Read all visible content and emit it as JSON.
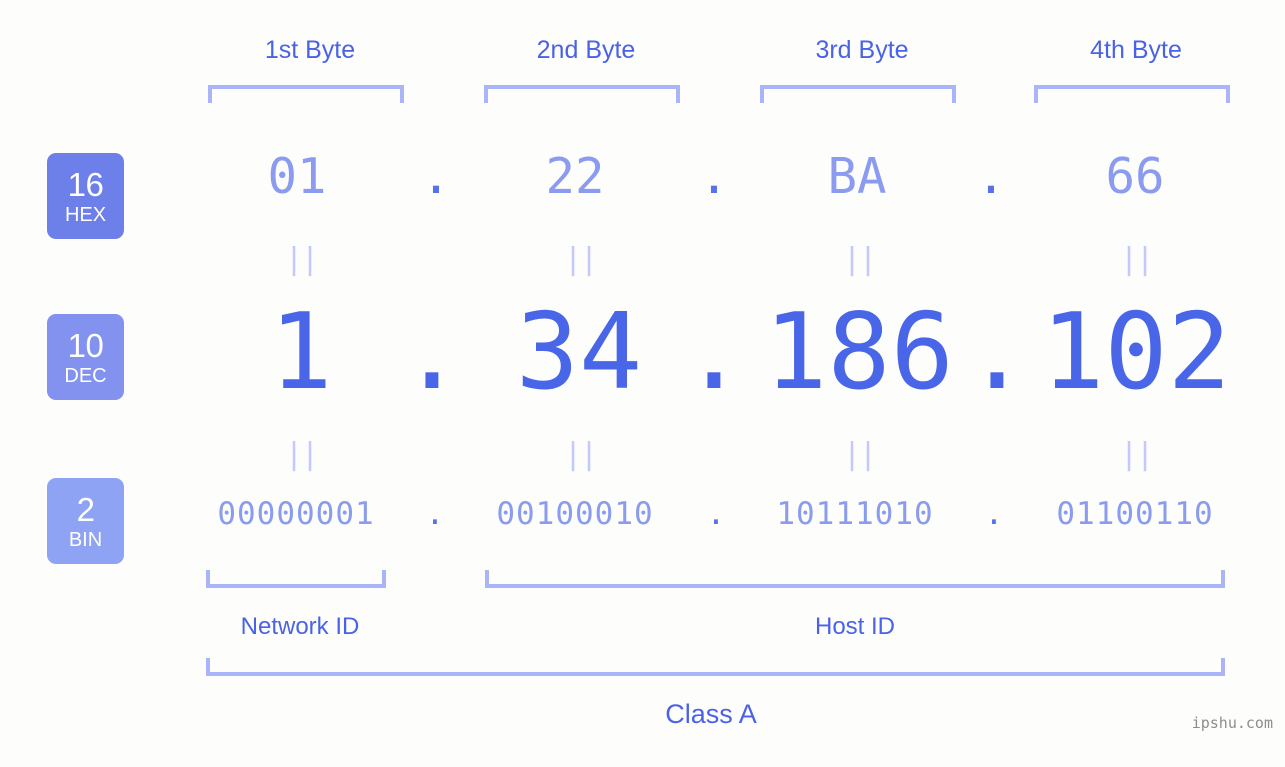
{
  "meta": {
    "background": "#fdfefb",
    "accent_dark": "#4a62e8",
    "accent_mid": "#6d7fe8",
    "accent_light": "#8a9bf0",
    "bracket": "#aab4f9",
    "watermark": "ipshu.com"
  },
  "byte_headers": [
    {
      "label": "1st Byte"
    },
    {
      "label": "2nd Byte"
    },
    {
      "label": "3rd Byte"
    },
    {
      "label": "4th Byte"
    }
  ],
  "rows": {
    "hex": {
      "badge_num": "16",
      "badge_abbr": "HEX",
      "values": [
        "01",
        "22",
        "BA",
        "66"
      ],
      "separator": "."
    },
    "dec": {
      "badge_num": "10",
      "badge_abbr": "DEC",
      "values": [
        "1",
        "34",
        "186",
        "102"
      ],
      "separator": "."
    },
    "bin": {
      "badge_num": "2",
      "badge_abbr": "BIN",
      "values": [
        "00000001",
        "00100010",
        "10111010",
        "01100110"
      ],
      "separator": "."
    }
  },
  "equality": {
    "mark": "||"
  },
  "segments": {
    "network_id": "Network ID",
    "host_id": "Host ID",
    "class": "Class A"
  }
}
